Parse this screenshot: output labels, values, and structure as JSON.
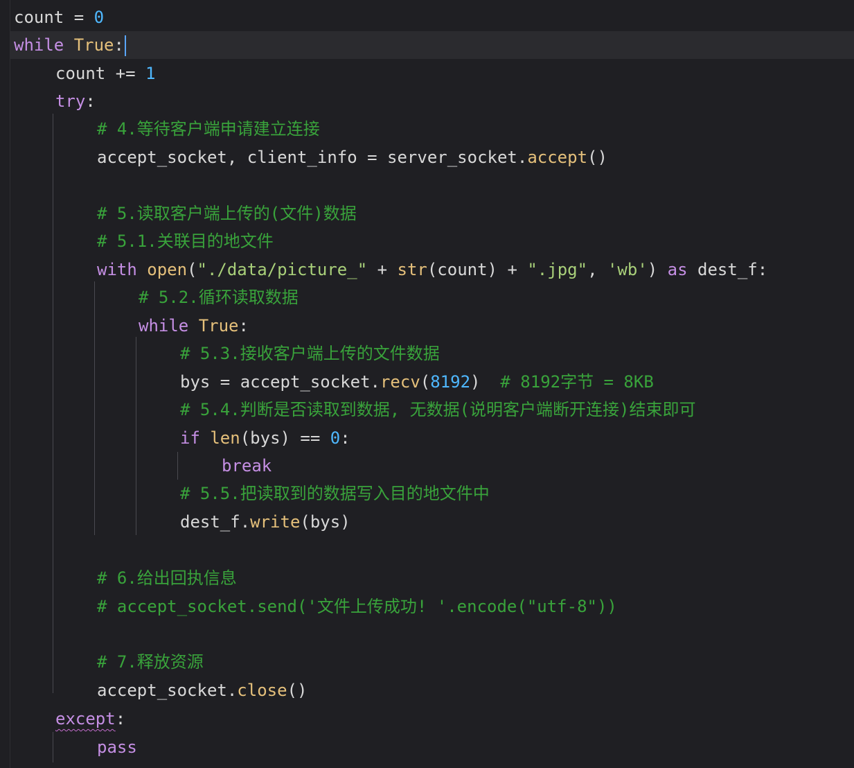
{
  "editor": {
    "language": "python",
    "colors": {
      "background": "#1f1f23",
      "current_line": "#2b2b2f",
      "keyword": "#c58fe4",
      "function": "#e5c07b",
      "number": "#4fb8ff",
      "string": "#a9d07a",
      "comment": "#39a33b",
      "text": "#d8d8d8",
      "caret": "#59a6ff"
    },
    "lines": [
      {
        "tokens": [
          [
            "count",
            ""
          ],
          [
            " = ",
            ""
          ],
          [
            "0",
            "num"
          ]
        ]
      },
      {
        "tokens": [
          [
            "while",
            "kw"
          ],
          [
            " ",
            ""
          ],
          [
            "True",
            "bi"
          ],
          [
            ":",
            ""
          ]
        ],
        "current": true,
        "caret_after": true
      },
      {
        "tokens": [
          [
            "count",
            ""
          ],
          [
            " += ",
            ""
          ],
          [
            "1",
            "num"
          ]
        ]
      },
      {
        "tokens": [
          [
            "try",
            "kw"
          ],
          [
            ":",
            ""
          ]
        ]
      },
      {
        "tokens": [
          [
            "# 4.等待客户端申请建立连接",
            "cm"
          ]
        ]
      },
      {
        "tokens": [
          [
            "accept_socket, client_info = server_socket.",
            ""
          ],
          [
            "accept",
            "fn"
          ],
          [
            "()",
            ""
          ]
        ]
      },
      {
        "tokens": []
      },
      {
        "tokens": [
          [
            "# 5.读取客户端上传的(文件)数据",
            "cm"
          ]
        ]
      },
      {
        "tokens": [
          [
            "# 5.1.关联目的地文件",
            "cm"
          ]
        ]
      },
      {
        "tokens": [
          [
            "with",
            "kw"
          ],
          [
            " ",
            ""
          ],
          [
            "open",
            "fn"
          ],
          [
            "(",
            ""
          ],
          [
            "\"./data/picture_\"",
            "str"
          ],
          [
            " + ",
            ""
          ],
          [
            "str",
            "bi"
          ],
          [
            "(count) + ",
            ""
          ],
          [
            "\".jpg\"",
            "str"
          ],
          [
            ", ",
            ""
          ],
          [
            "'wb'",
            "str"
          ],
          [
            ") ",
            ""
          ],
          [
            "as",
            "kw"
          ],
          [
            " dest_f:",
            ""
          ]
        ]
      },
      {
        "tokens": [
          [
            "# 5.2.循环读取数据",
            "cm"
          ]
        ]
      },
      {
        "tokens": [
          [
            "while",
            "kw"
          ],
          [
            " ",
            ""
          ],
          [
            "True",
            "bi"
          ],
          [
            ":",
            ""
          ]
        ]
      },
      {
        "tokens": [
          [
            "# 5.3.接收客户端上传的文件数据",
            "cm"
          ]
        ]
      },
      {
        "tokens": [
          [
            "bys = accept_socket.",
            ""
          ],
          [
            "recv",
            "fn"
          ],
          [
            "(",
            ""
          ],
          [
            "8192",
            "num"
          ],
          [
            ")  ",
            ""
          ],
          [
            "# 8192字节 = 8KB",
            "cm"
          ]
        ]
      },
      {
        "tokens": [
          [
            "# 5.4.判断是否读取到数据, 无数据(说明客户端断开连接)结束即可",
            "cm"
          ]
        ]
      },
      {
        "tokens": [
          [
            "if",
            "kw"
          ],
          [
            " ",
            ""
          ],
          [
            "len",
            "bi"
          ],
          [
            "(bys) == ",
            ""
          ],
          [
            "0",
            "num"
          ],
          [
            ":",
            ""
          ]
        ]
      },
      {
        "tokens": [
          [
            "break",
            "kw"
          ]
        ]
      },
      {
        "tokens": [
          [
            "# 5.5.把读取到的数据写入目的地文件中",
            "cm"
          ]
        ]
      },
      {
        "tokens": [
          [
            "dest_f.",
            ""
          ],
          [
            "write",
            "fn"
          ],
          [
            "(bys)",
            ""
          ]
        ]
      },
      {
        "tokens": []
      },
      {
        "tokens": [
          [
            "# 6.给出回执信息",
            "cm"
          ]
        ]
      },
      {
        "tokens": [
          [
            "# accept_socket.send('文件上传成功! '.encode(\"utf-8\"))",
            "cm"
          ]
        ]
      },
      {
        "tokens": []
      },
      {
        "tokens": [
          [
            "# 7.释放资源",
            "cm"
          ]
        ]
      },
      {
        "tokens": [
          [
            "accept_socket.",
            ""
          ],
          [
            "close",
            "fn"
          ],
          [
            "()",
            ""
          ]
        ]
      },
      {
        "tokens": [
          [
            "except",
            "kw squiggle"
          ],
          [
            ":",
            ""
          ]
        ]
      },
      {
        "tokens": [
          [
            "pass",
            "kw"
          ]
        ]
      }
    ]
  }
}
